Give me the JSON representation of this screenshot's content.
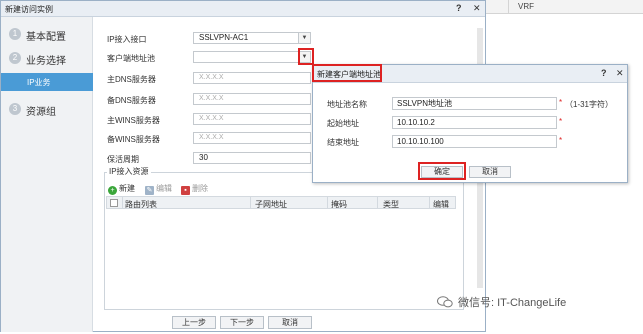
{
  "background": {
    "vrf_label": "VRF"
  },
  "dialog": {
    "title": "新建访问实例",
    "help": "?",
    "close": "✕",
    "steps": [
      {
        "num": "1",
        "label": "基本配置"
      },
      {
        "num": "2",
        "label": "业务选择"
      },
      {
        "num": "",
        "label": "IP业务"
      },
      {
        "num": "3",
        "label": "资源组"
      }
    ],
    "fields": {
      "ip_interface_label": "IP接入接口",
      "ip_interface_value": "SSLVPN-AC1",
      "client_pool_label": "客户端地址池",
      "primary_dns_label": "主DNS服务器",
      "primary_dns_placeholder": "X.X.X.X",
      "backup_dns_label": "备DNS服务器",
      "backup_dns_placeholder": "X.X.X.X",
      "primary_wins_label": "主WINS服务器",
      "primary_wins_placeholder": "X.X.X.X",
      "backup_wins_label": "备WINS服务器",
      "backup_wins_placeholder": "X.X.X.X",
      "keepalive_label": "保活周期",
      "keepalive_value": "30"
    },
    "resources": {
      "legend": "IP接入资源",
      "toolbar": {
        "new": "新建",
        "edit": "编辑",
        "delete": "删除"
      },
      "columns": [
        "路由列表",
        "子网地址",
        "掩码",
        "类型",
        "编辑"
      ]
    },
    "footer": {
      "prev": "上一步",
      "next": "下一步",
      "cancel": "取消"
    }
  },
  "subdialog": {
    "title": "新建客户端地址池",
    "help": "?",
    "close": "✕",
    "pool_name_label": "地址池名称",
    "pool_name_value": "SSLVPN地址池",
    "pool_name_hint": "（1-31字符）",
    "start_label": "起始地址",
    "start_value": "10.10.10.2",
    "end_label": "结束地址",
    "end_value": "10.10.10.100",
    "ok": "确定",
    "cancel": "取消",
    "required_mark": "*"
  },
  "watermark": {
    "text": "微信号: IT-ChangeLife"
  },
  "colors": {
    "highlight": "#dd2222",
    "selected_step": "#4a9bd6",
    "new_icon": "#3aa63a",
    "delete_icon": "#d04040"
  }
}
